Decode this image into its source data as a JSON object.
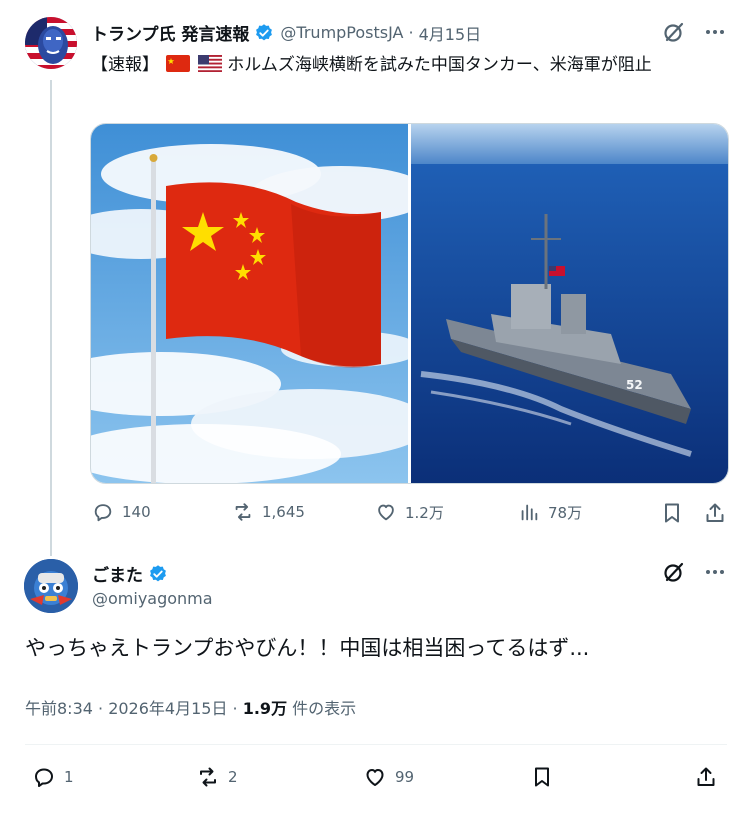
{
  "tweet1": {
    "display_name": "トランプ氏 発言速報",
    "handle": "@TrumpPostsJA",
    "separator": "·",
    "date": "4月15日",
    "text_prefix": "【速報】",
    "text_body": "ホルムズ海峡横断を試みた中国タンカー、米海軍が阻止",
    "stats": {
      "replies": "140",
      "reposts": "1,645",
      "likes": "1.2万",
      "views": "78万"
    }
  },
  "tweet2": {
    "display_name": "ごまた",
    "handle": "@omiyagonma",
    "text": "やっちゃえトランプおやびん！！中国は相当困ってるはず...",
    "meta_time": "午前8:34 · 2026年4月15日 ·",
    "meta_views": "1.9万",
    "meta_views_label": "件の表示",
    "stats": {
      "replies": "1",
      "reposts": "2",
      "likes": "99"
    }
  },
  "colors": {
    "verified_blue": "#1d9bf0",
    "secondary_text": "#536471",
    "primary_text": "#0f1419"
  },
  "icons": [
    "grok-icon",
    "more-icon",
    "reply-icon",
    "repost-icon",
    "like-icon",
    "views-icon",
    "bookmark-icon",
    "share-icon",
    "verified-badge-icon"
  ]
}
